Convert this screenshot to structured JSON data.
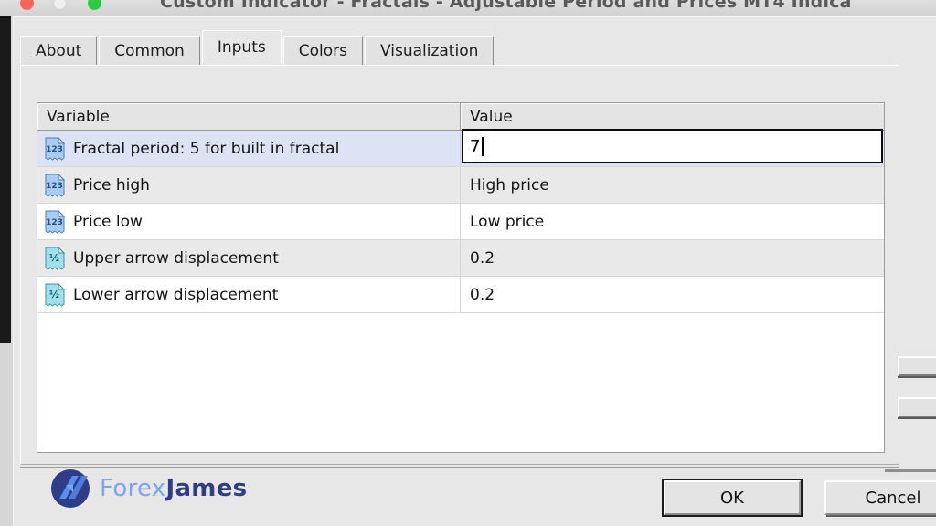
{
  "window": {
    "title": "Custom Indicator - Fractals - Adjustable Period and Prices MT4 Indica",
    "traffic_lights": {
      "close": "close-button",
      "minimize": "minimize-button",
      "zoom": "zoom-button"
    },
    "colors": {
      "close": "#fd6157",
      "minimize": "#efefef",
      "zoom": "#29cc41"
    }
  },
  "tabs": [
    {
      "label": "About",
      "selected": false
    },
    {
      "label": "Common",
      "selected": false
    },
    {
      "label": "Inputs",
      "selected": true
    },
    {
      "label": "Colors",
      "selected": false
    },
    {
      "label": "Visualization",
      "selected": false
    }
  ],
  "table": {
    "headers": {
      "variable": "Variable",
      "value": "Value"
    },
    "rows": [
      {
        "icon": "integer-type-icon",
        "icon_glyph": "123",
        "variable": "Fractal period: 5 for built in fractal",
        "value": "7",
        "editing": true,
        "selected": true
      },
      {
        "icon": "integer-type-icon",
        "icon_glyph": "123",
        "variable": "Price high",
        "value": "High price",
        "editing": false,
        "selected": false
      },
      {
        "icon": "integer-type-icon",
        "icon_glyph": "123",
        "variable": "Price low",
        "value": "Low price",
        "editing": false,
        "selected": false
      },
      {
        "icon": "double-type-icon",
        "icon_glyph": "1/2",
        "variable": "Upper arrow displacement",
        "value": "0.2",
        "editing": false,
        "selected": false
      },
      {
        "icon": "double-type-icon",
        "icon_glyph": "1/2",
        "variable": "Lower arrow displacement",
        "value": "0.2",
        "editing": false,
        "selected": false
      }
    ]
  },
  "branding": {
    "name_light": "Forex",
    "name_bold": "James",
    "colors": {
      "light": "#7aa6ef",
      "bold": "#2e3d87",
      "mark_dark": "#2e3d87",
      "mark_light": "#5b8def"
    }
  },
  "buttons": {
    "ok": "OK",
    "cancel": "Cancel"
  },
  "theme": {
    "selected_row": "#dde3f5",
    "alt_row": "#e9e9e9",
    "dialog_bg": "#e7e7e7",
    "integer_icon": "#4f8fd4",
    "double_icon": "#5fc6d8"
  }
}
